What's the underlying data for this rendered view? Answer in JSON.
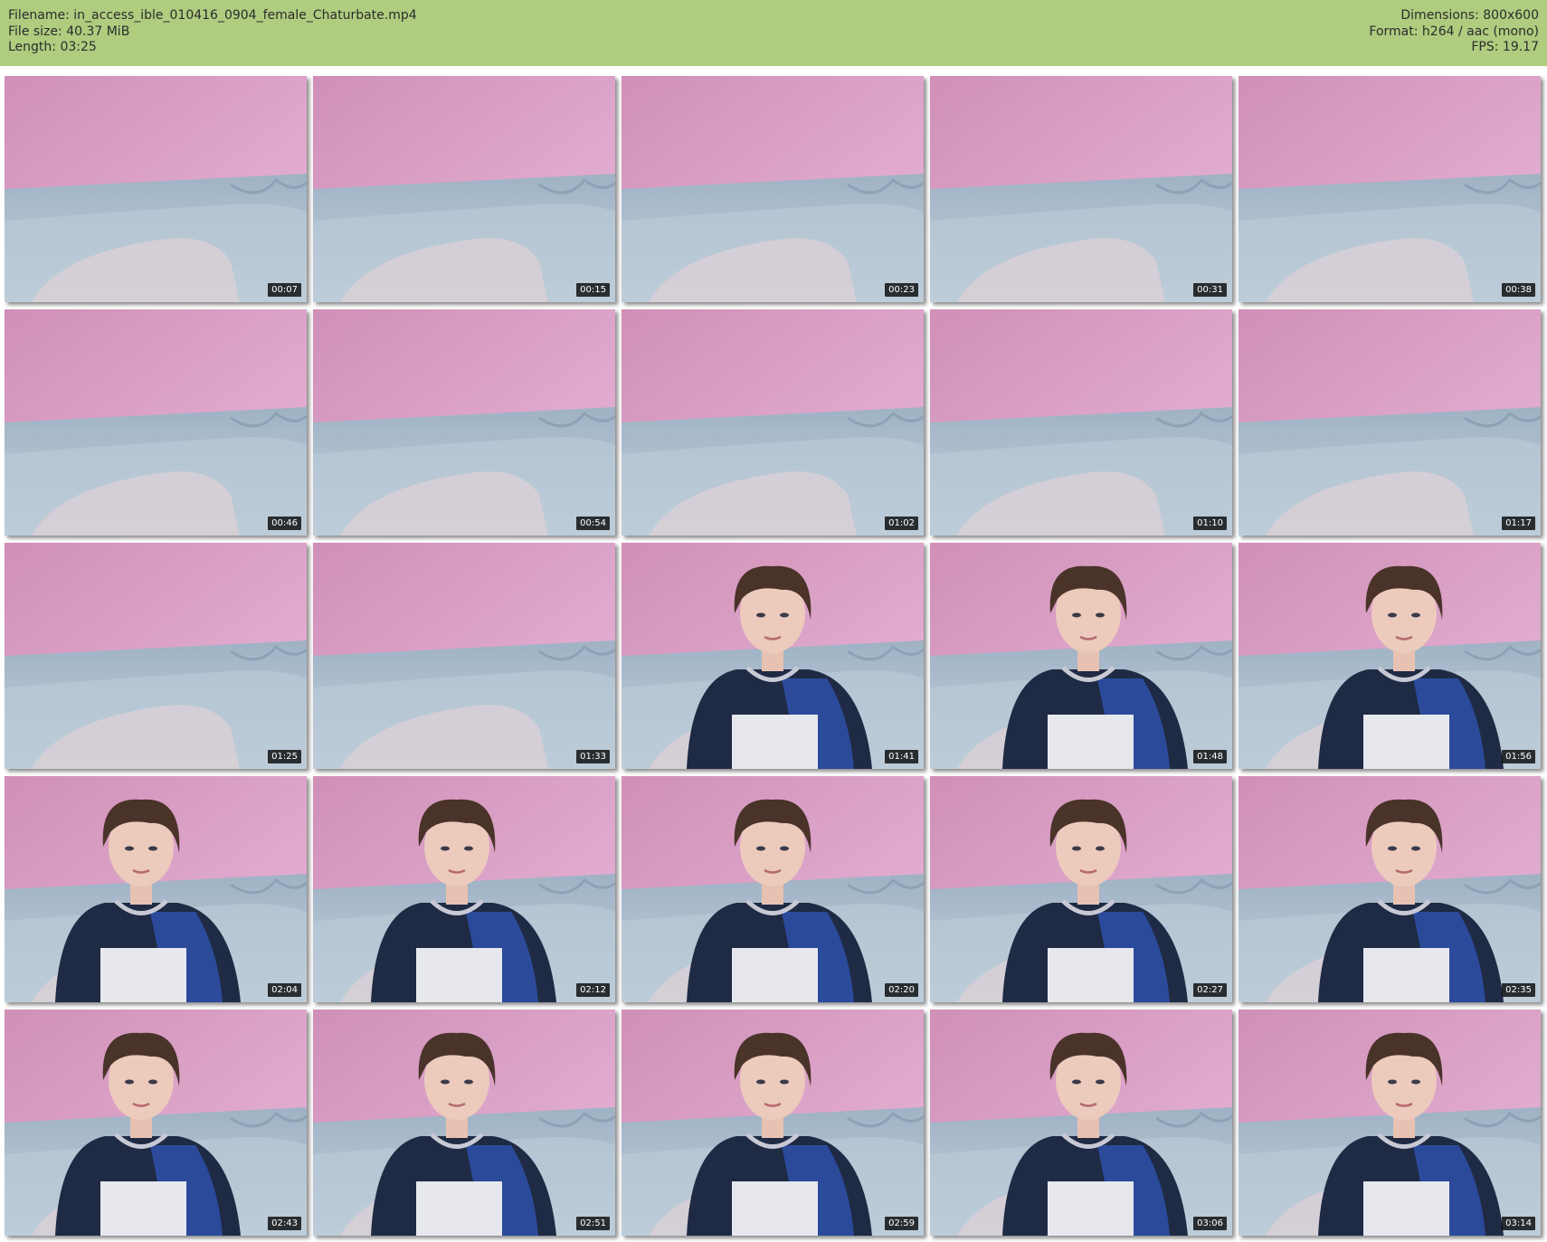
{
  "header": {
    "filename": "Filename: in_access_ible_010416_0904_female_Chaturbate.mp4",
    "filesize": "File size: 40.37 MiB",
    "length": "Length: 03:25",
    "dimensions": "Dimensions: 800x600",
    "format": "Format: h264 / aac (mono)",
    "fps": "FPS: 19.17"
  },
  "colors": {
    "header_bg": "#afcc7f",
    "wall": "#d9a4c6",
    "sheet": "#aebfd0",
    "timestamp_bg": "#000000"
  },
  "thumbnails": [
    {
      "time": "00:07",
      "person": false
    },
    {
      "time": "00:15",
      "person": false
    },
    {
      "time": "00:23",
      "person": false
    },
    {
      "time": "00:31",
      "person": false
    },
    {
      "time": "00:38",
      "person": false
    },
    {
      "time": "00:46",
      "person": false
    },
    {
      "time": "00:54",
      "person": false
    },
    {
      "time": "01:02",
      "person": false
    },
    {
      "time": "01:10",
      "person": false
    },
    {
      "time": "01:17",
      "person": false
    },
    {
      "time": "01:25",
      "person": false
    },
    {
      "time": "01:33",
      "person": false
    },
    {
      "time": "01:41",
      "person": true
    },
    {
      "time": "01:48",
      "person": true
    },
    {
      "time": "01:56",
      "person": true
    },
    {
      "time": "02:04",
      "person": true
    },
    {
      "time": "02:12",
      "person": true
    },
    {
      "time": "02:20",
      "person": true
    },
    {
      "time": "02:27",
      "person": true
    },
    {
      "time": "02:35",
      "person": true
    },
    {
      "time": "02:43",
      "person": true
    },
    {
      "time": "02:51",
      "person": true
    },
    {
      "time": "02:59",
      "person": true
    },
    {
      "time": "03:06",
      "person": true
    },
    {
      "time": "03:14",
      "person": true
    }
  ]
}
